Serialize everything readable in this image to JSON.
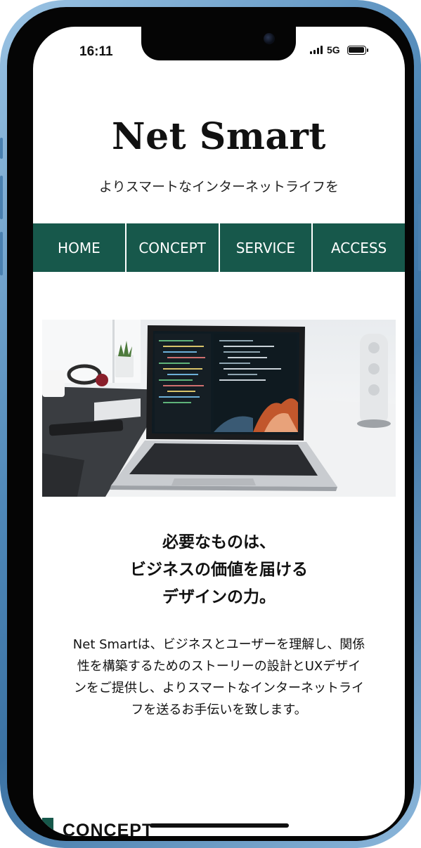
{
  "status_bar": {
    "time": "16:11",
    "network": "5G",
    "battery_level": 1.0
  },
  "header": {
    "site_title": "Net Smart",
    "tagline": "よりスマートなインターネットライフを"
  },
  "nav": {
    "items": [
      {
        "label": "HOME"
      },
      {
        "label": "CONCEPT"
      },
      {
        "label": "SERVICE"
      },
      {
        "label": "ACCESS"
      }
    ]
  },
  "main": {
    "headline_lines": [
      "必要なものは、",
      "ビジネスの価値を届ける",
      "デザインの力。"
    ],
    "body_lines": [
      "Net Smartは、ビジネスとユーザーを理解し、関係",
      "性を構築するためのストーリーの設計とUXデザイ",
      "ンをご提供し、よりスマートなインターネットライ",
      "フを送るお手伝いを致します。"
    ],
    "section_title": "CONCEPT"
  },
  "colors": {
    "brand_green": "#17584b",
    "frame_blue": "#4f88b8"
  },
  "icons": {
    "signal": "signal-icon",
    "battery": "battery-icon",
    "camera": "front-camera-icon"
  }
}
